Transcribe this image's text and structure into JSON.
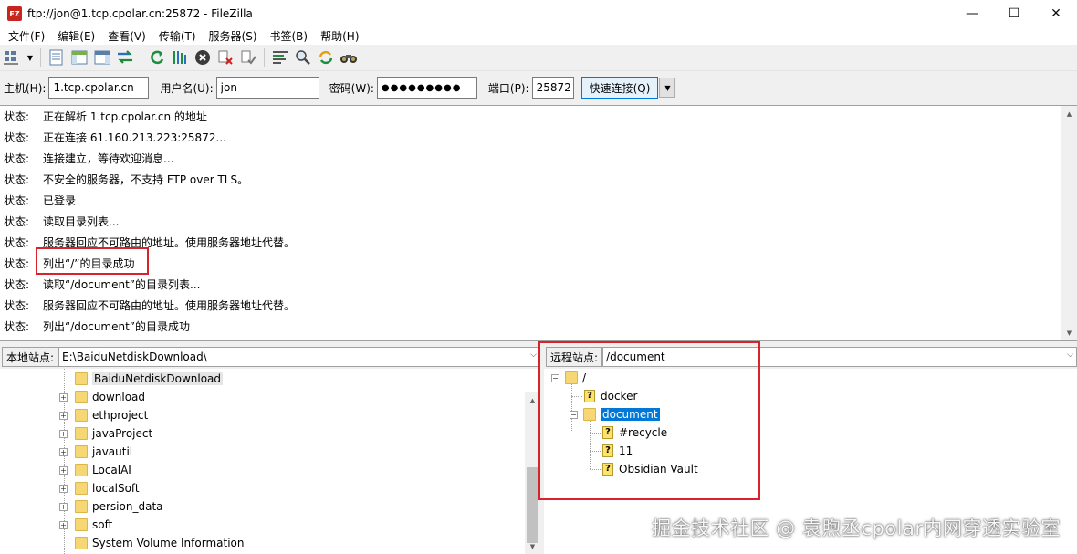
{
  "window": {
    "title": "ftp://jon@1.tcp.cpolar.cn:25872 - FileZilla",
    "app_icon_text": "FZ",
    "minimize": "—",
    "maximize": "☐",
    "close": "✕"
  },
  "menu": [
    "文件(F)",
    "编辑(E)",
    "查看(V)",
    "传输(T)",
    "服务器(S)",
    "书签(B)",
    "帮助(H)"
  ],
  "toolbar": {
    "icons": [
      "site-manager-icon",
      "toggle-log-icon",
      "toggle-local-tree-icon",
      "toggle-remote-tree-icon",
      "toggle-queue-icon",
      "refresh-icon",
      "process-queue-icon",
      "cancel-icon",
      "disconnect-icon",
      "reconnect-icon",
      "directory-filter-icon",
      "search-icon",
      "sync-browse-icon",
      "find-files-icon"
    ]
  },
  "quickconnect": {
    "host_label": "主机(H):",
    "host_value": "1.tcp.cpolar.cn",
    "user_label": "用户名(U):",
    "user_value": "jon",
    "pass_label": "密码(W):",
    "pass_value": "●●●●●●●●●",
    "port_label": "端口(P):",
    "port_value": "25872",
    "connect_label": "快速连接(Q)"
  },
  "log": [
    {
      "type": "状态:",
      "text": "正在解析 1.tcp.cpolar.cn 的地址"
    },
    {
      "type": "状态:",
      "text": "正在连接 61.160.213.223:25872..."
    },
    {
      "type": "状态:",
      "text": "连接建立，等待欢迎消息..."
    },
    {
      "type": "状态:",
      "text": "不安全的服务器，不支持 FTP over TLS。"
    },
    {
      "type": "状态:",
      "text": "已登录"
    },
    {
      "type": "状态:",
      "text": "读取目录列表..."
    },
    {
      "type": "状态:",
      "text": "服务器回应不可路由的地址。使用服务器地址代替。"
    },
    {
      "type": "状态:",
      "text": "列出“/”的目录成功"
    },
    {
      "type": "状态:",
      "text": "读取“/document”的目录列表..."
    },
    {
      "type": "状态:",
      "text": "服务器回应不可路由的地址。使用服务器地址代替。"
    },
    {
      "type": "状态:",
      "text": "列出“/document”的目录成功"
    }
  ],
  "local": {
    "site_label": "本地站点:",
    "path": "E:\\BaiduNetdiskDownload\\",
    "items": [
      "BaiduNetdiskDownload",
      "download",
      "ethproject",
      "javaProject",
      "javautil",
      "LocalAI",
      "localSoft",
      "persion_data",
      "soft",
      "System Volume Information"
    ]
  },
  "remote": {
    "site_label": "远程站点:",
    "path": "/document",
    "root": "/",
    "items": [
      "docker",
      "document",
      "#recycle",
      "11",
      "Obsidian Vault"
    ]
  },
  "watermark": "掘金技术社区 @ 袁煦丞cpolar内网穿透实验室"
}
